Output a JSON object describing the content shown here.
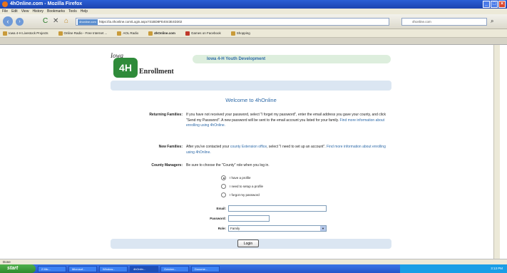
{
  "window": {
    "title": "4hOnline.com - Mozilla Firefox"
  },
  "menu": [
    "File",
    "Edit",
    "View",
    "History",
    "Bookmarks",
    "Tools",
    "Help"
  ],
  "nav": {
    "site_badge": "4honline.com",
    "url": "https://ia.4honline.com/Login.aspx?31BD8FE4043E4D302",
    "search_placeholder": "4honline.com"
  },
  "bookmarks": [
    "Iowa 4-H Livestock Projects",
    "Online Radio - Free Internet ...",
    "AOL Radio",
    "4hOnline.com",
    "Games on Facebook",
    "Shopping"
  ],
  "page": {
    "logo_state": "Iowa",
    "logo_mark": "4H",
    "logo_word": "Enrollment",
    "header_title": "Iowa 4-H Youth Development",
    "welcome": "Welcome to 4hOnline",
    "returning_label": "Returning Families:",
    "returning_text": "If you have not received your password, select \"I forget my password\", enter the email address you gave your county, and click \"Send my Password\". A new password will be sent to the email account you listed for your family.",
    "returning_link": "Find more information about enrolling using 4hOnline.",
    "new_label": "New Families:",
    "new_text_1": "After you've contacted your",
    "new_link_1": "county Extension office",
    "new_text_2": ", select \"I need to set up an account\".",
    "new_link_2": "Find more information about enrolling using 4hOnline.",
    "county_label": "County Managers:",
    "county_text": "Be sure to choose the \"County\" role when you log in.",
    "radio_1": "I have a profile",
    "radio_2": "I need to setup a profile",
    "radio_3": "I forgot my password",
    "email_label": "Email:",
    "password_label": "Password:",
    "role_label": "Role:",
    "role_value": "Family",
    "login_label": "Login"
  },
  "status": {
    "text": "Done"
  },
  "taskbar": {
    "start": "start",
    "tasks": [
      "2 Mic...",
      "Microsof...",
      "Window...",
      "4hOnlin...",
      "October...",
      "Docume..."
    ],
    "clock": "3:13 PM"
  }
}
